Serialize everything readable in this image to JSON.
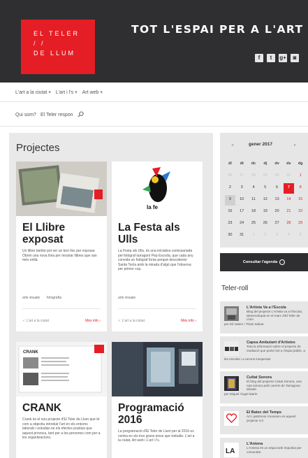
{
  "logo": {
    "line1": "EL TELER",
    "line2": "/       /",
    "line3": "DE LLUM"
  },
  "header": {
    "tagline": "TOT L'ESPAI PER A L'ART"
  },
  "socials": [
    {
      "icon": "facebook-icon",
      "glyph": "f"
    },
    {
      "icon": "twitter-icon",
      "glyph": "t"
    },
    {
      "icon": "google-plus-icon",
      "glyph": "g+"
    },
    {
      "icon": "instagram-icon",
      "glyph": "◙"
    }
  ],
  "nav_primary": [
    {
      "label": "L'art a la ciutat"
    },
    {
      "label": "L'art i l's"
    },
    {
      "label": "Art web"
    }
  ],
  "nav_secondary": [
    {
      "label": "Qui som?"
    },
    {
      "label": "El Teler respon"
    }
  ],
  "projects": {
    "title": "Projectes",
    "cards": [
      {
        "title": "El Llibre exposat",
        "excerpt": "Un llibre també pot ser un bon lloc per exposar. Obrim una nova línia per mostrar llibres que van més enllà.",
        "tags": [
          "arts visuals",
          "fotografia"
        ],
        "category": "L'art a la ciutat",
        "more": "Més info"
      },
      {
        "title": "La Festa als Ulls",
        "excerpt": "La Festa als Ulls, és una iniciativa comissariada pel fotògraf tarragoní Pep Escoda, que cada any convida un fotògraf foràs perquè descobreixi Santa Tecla amb la mirada d'algú que l'observa per primer cop.",
        "tags": [
          "arts visuals"
        ],
        "category": "L'art a la ciutat",
        "more": "Més info"
      },
      {
        "title": "CRANK",
        "excerpt": "Crank és el nou projecte d'El Teler de Llum que té com a objectiu introduir l'art en els entorns laborals i estudiar-ne els efectes positius que aquest provoca, tant per a les persones com per a les organitzacions."
      },
      {
        "title": "Programació 2016",
        "excerpt": "La programació d'El Teler de Llum per al 2016 es centra en els tres grans eixos que treballa: L'art a la ciutat, Art web i L'art i l's."
      }
    ]
  },
  "calendar": {
    "month": "gener 2017",
    "prev": "◂",
    "next": "▸",
    "dow": [
      "dl",
      "dt",
      "dc",
      "dj",
      "dv",
      "ds",
      "dg"
    ],
    "weeks": [
      [
        "26",
        "27",
        "28",
        "29",
        "30",
        "31",
        "1"
      ],
      [
        "2",
        "3",
        "4",
        "5",
        "6",
        "7",
        "8"
      ],
      [
        "9",
        "10",
        "11",
        "12",
        "13",
        "14",
        "15"
      ],
      [
        "16",
        "17",
        "18",
        "19",
        "20",
        "21",
        "22"
      ],
      [
        "23",
        "24",
        "25",
        "26",
        "27",
        "28",
        "29"
      ],
      [
        "30",
        "31",
        "1",
        "2",
        "3",
        "4",
        "5"
      ]
    ],
    "today": "7",
    "button": "Consultar l'agenda"
  },
  "teler_roll": {
    "title": "Teler-roll",
    "items": [
      {
        "title": "L'Artista Va a l'Escola",
        "desc": "Blog del projecte L'Artista va a l'Escola, desenvolupat en el marc d'El Teler de Llum",
        "by": "per Eli Valero i Thaïs Salvat"
      },
      {
        "title": "Capsa Ambulant d'Artistes",
        "desc": "Tota la informació sobre el projecte de mediació que porta l'art a l'espai públic, a",
        "by": "les escoles i a racons inesperats"
      },
      {
        "title": "Cultat Sonora",
        "desc": "El blog del projecte Ciutat Sonora, una ruta sonora pels carrers de Tarragona ideada",
        "by": "per Miquel Àngel Marín"
      },
      {
        "title": "El Batec del Temps",
        "desc": "Art i patrimoni s'uneixen en aquest projecte 3.0",
        "by": ""
      },
      {
        "title": "L'Antena",
        "desc": "L'Antena és un espai web impulsat per comunitat.",
        "by": ""
      }
    ]
  }
}
